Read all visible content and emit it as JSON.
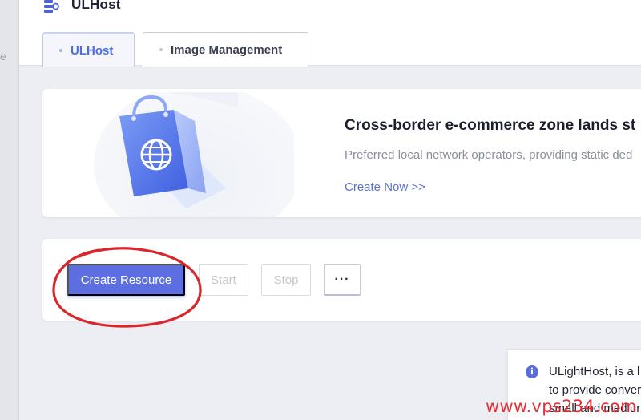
{
  "sidebar": {
    "partial_label": "e"
  },
  "header": {
    "title": "ULHost",
    "icon": "server-stack-icon"
  },
  "tabs": [
    {
      "label": "ULHost",
      "active": true
    },
    {
      "label": "Image Management",
      "active": false
    }
  ],
  "banner": {
    "title": "Cross-border e-commerce zone lands st",
    "description": "Preferred local network operators, providing static ded",
    "link": "Create Now >>",
    "illustration": "shopping-bag-globe-icon"
  },
  "toolbar": {
    "create_label": "Create Resource",
    "start_label": "Start",
    "stop_label": "Stop",
    "more_label": "···"
  },
  "info": {
    "icon": "info-icon",
    "icon_glyph": "i",
    "line1": "ULightHost, is a l",
    "line2": "to provide conver",
    "line3": "small and mediur"
  },
  "watermark": "www.vps234.com",
  "colors": {
    "accent": "#5d6fe0",
    "tab_active": "#4a6fe3",
    "annotation": "#e3262b"
  }
}
